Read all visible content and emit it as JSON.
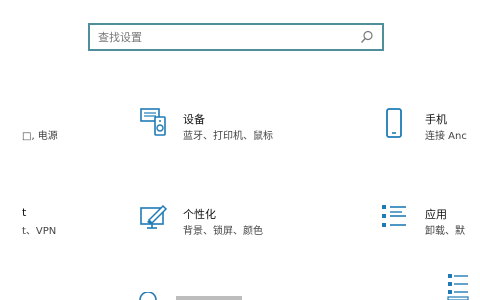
{
  "search": {
    "placeholder": "查找设置"
  },
  "tiles": [
    {
      "title": "",
      "subtitle": "□, 电源",
      "icon": "power-icon"
    },
    {
      "title": "设备",
      "subtitle": "蓝牙、打印机、鼠标",
      "icon": "devices-icon"
    },
    {
      "title": "手机",
      "subtitle": "连接 Anc",
      "icon": "phone-icon"
    },
    {
      "title": "t",
      "subtitle": "t、VPN",
      "icon": "network-icon"
    },
    {
      "title": "个性化",
      "subtitle": "背景、锁屏、颜色",
      "icon": "personalization-icon"
    },
    {
      "title": "应用",
      "subtitle": "卸载、默",
      "icon": "apps-icon"
    }
  ],
  "colors": {
    "accent": "#1f7bb6",
    "search_border": "#4f8f9a"
  }
}
